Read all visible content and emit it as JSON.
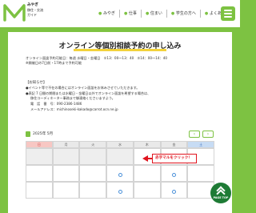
{
  "header": {
    "logo_line1": "みやぎ",
    "logo_line2": "移住・交流",
    "logo_line3": "ガイド",
    "nav": [
      "みやぎ",
      "仕事",
      "住まい",
      "学生の方へ",
      "よくある"
    ]
  },
  "main": {
    "title": "オンライン等個別相談予約の申し込み",
    "info_line1": "オンライン面談予約可能日：毎週 水曜日・金曜日　①13：00～13：40　②14：00～14：40",
    "info_line2": "※開催日の7日前・17時まで予約可能",
    "notice_title": "【お知らせ】",
    "bullet1": "●イベント等で不在の場合にはオンライン面談をお休みさせていただきます。",
    "bullet2": "●表記 7 日間の期間または水曜日・金曜日以外でオンライン面談を希望する場合は、",
    "bullet2_cont": "移住コーディネーター事務まで御連絡くださいますよう。",
    "phone_label": "電　話　番　号：090-2386-1486",
    "email_label": "メールアドレス：michinoseki-kakado@carrot.ocn.ne.jp"
  },
  "calendar": {
    "month_label": "2025年 5月",
    "prev": "‹",
    "next": "›",
    "days": [
      "日",
      "月",
      "火",
      "水",
      "木",
      "金",
      "土"
    ],
    "callout": "赤字マルをクリック！"
  },
  "pagetop": {
    "label": "PAGE TOP"
  },
  "colors": {
    "green": "#7dc242",
    "dark_green": "#1e7b35",
    "red": "#e0141e",
    "yellow": "#f3d23c"
  }
}
